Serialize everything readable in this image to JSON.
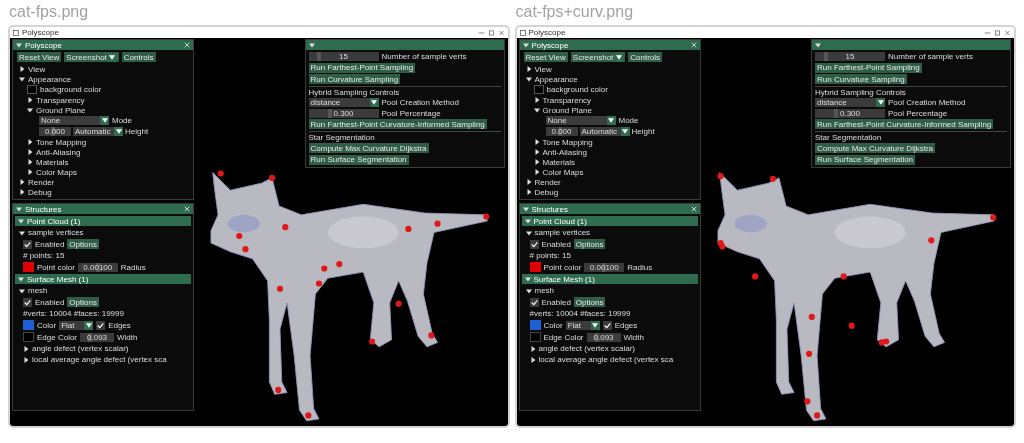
{
  "windows": [
    {
      "file_label": "cat-fps.png",
      "title": "Polyscope",
      "main_panel": {
        "title": "Polyscope",
        "buttons": [
          {
            "label": "Reset View",
            "kind": "plain"
          },
          {
            "label": "Screenshot",
            "kind": "menu"
          },
          {
            "label": "Controls",
            "kind": "plain"
          }
        ],
        "tree": [
          {
            "kind": "node",
            "label": "View",
            "expanded": false
          },
          {
            "kind": "node",
            "label": "Appearance",
            "expanded": true,
            "children": [
              {
                "kind": "color",
                "label": "background color",
                "color": "#000000"
              },
              {
                "kind": "node",
                "label": "Transparency",
                "expanded": false
              },
              {
                "kind": "node",
                "label": "Ground Plane",
                "expanded": true,
                "children": [
                  {
                    "kind": "select",
                    "value": "None",
                    "label": "Mode"
                  },
                  {
                    "kind": "drag_select",
                    "value": "0.000",
                    "level": 0.45,
                    "option": "Automatic",
                    "label": "Height"
                  }
                ]
              },
              {
                "kind": "node",
                "label": "Tone Mapping",
                "expanded": false
              },
              {
                "kind": "node",
                "label": "Anti-Aliasing",
                "expanded": false
              },
              {
                "kind": "node",
                "label": "Materials",
                "expanded": false
              },
              {
                "kind": "node",
                "label": "Color Maps",
                "expanded": false
              }
            ]
          },
          {
            "kind": "node",
            "label": "Render",
            "expanded": false
          },
          {
            "kind": "node",
            "label": "Debug",
            "expanded": false
          }
        ]
      },
      "structures": {
        "title": "Structures",
        "groups": [
          {
            "title": "Point Cloud (1)",
            "items": [
              {
                "name": "sample vertices",
                "expanded": true,
                "enabled": true,
                "enabled_label": "Enabled",
                "options": "Options",
                "info": "# points: 15",
                "color": "#e00000",
                "color_label": "Point color",
                "param": {
                  "value": "0.00100",
                  "level": 0.5,
                  "label": "Radius"
                }
              }
            ]
          },
          {
            "title": "Surface Mesh (1)",
            "items": [
              {
                "name": "mesh",
                "expanded": true,
                "enabled": true,
                "enabled_label": "Enabled",
                "options": "Options",
                "info": "#verts: 10004  #faces: 19999",
                "color": "#1f5fd6",
                "color_label": "Color",
                "style": "Flat",
                "edges": {
                  "checked": true,
                  "label": "Edges"
                },
                "edge_color": {
                  "color": "#000000",
                  "label": "Edge Color"
                },
                "param": {
                  "value": "0.093",
                  "level": 0.3,
                  "label": "Width"
                },
                "quantities": [
                  {
                    "label": "angle defect (vertex scalar)",
                    "expanded": false
                  },
                  {
                    "label": "local average angle defect (vertex sca",
                    "expanded": false
                  }
                ]
              }
            ]
          }
        ]
      },
      "tools": [
        {
          "kind": "slider",
          "reading": "15",
          "level": 0.15,
          "label": "Number of sample verts"
        },
        {
          "kind": "button",
          "label": "Run Farthest-Point Sampling"
        },
        {
          "kind": "button",
          "label": "Run Curvature Sampling"
        },
        {
          "kind": "heading",
          "label": "Hybrid Sampling Controls"
        },
        {
          "kind": "select",
          "option": "distance",
          "label": "Pool Creation Method"
        },
        {
          "kind": "slider",
          "reading": "0.300",
          "level": 0.3,
          "label": "Pool Percentage"
        },
        {
          "kind": "button",
          "label": "Run Farthest-Point Curvature-Informed Sampling"
        },
        {
          "kind": "heading",
          "label": "Star Segmentation"
        },
        {
          "kind": "button",
          "label": "Compute Max Curvature Dijkstra"
        },
        {
          "kind": "button",
          "label": "Run Surface Segmentation"
        }
      ]
    },
    {
      "file_label": "cat-fps+curv.png",
      "title": "Polyscope",
      "main_panel": {
        "title": "Polyscope",
        "buttons": [
          {
            "label": "Reset View",
            "kind": "plain"
          },
          {
            "label": "Screenshot",
            "kind": "menu"
          },
          {
            "label": "Controls",
            "kind": "plain"
          }
        ],
        "tree": [
          {
            "kind": "node",
            "label": "View",
            "expanded": false
          },
          {
            "kind": "node",
            "label": "Appearance",
            "expanded": true,
            "children": [
              {
                "kind": "color",
                "label": "background color",
                "color": "#000000"
              },
              {
                "kind": "node",
                "label": "Transparency",
                "expanded": false
              },
              {
                "kind": "node",
                "label": "Ground Plane",
                "expanded": true,
                "children": [
                  {
                    "kind": "select",
                    "value": "None",
                    "label": "Mode"
                  },
                  {
                    "kind": "drag_select",
                    "value": "0.000",
                    "level": 0.45,
                    "option": "Automatic",
                    "label": "Height"
                  }
                ]
              },
              {
                "kind": "node",
                "label": "Tone Mapping",
                "expanded": false
              },
              {
                "kind": "node",
                "label": "Anti-Aliasing",
                "expanded": false
              },
              {
                "kind": "node",
                "label": "Materials",
                "expanded": false
              },
              {
                "kind": "node",
                "label": "Color Maps",
                "expanded": false
              }
            ]
          },
          {
            "kind": "node",
            "label": "Render",
            "expanded": false
          },
          {
            "kind": "node",
            "label": "Debug",
            "expanded": false
          }
        ]
      },
      "structures": {
        "title": "Structures",
        "groups": [
          {
            "title": "Point Cloud (1)",
            "items": [
              {
                "name": "sample vertices",
                "expanded": true,
                "enabled": true,
                "enabled_label": "Enabled",
                "options": "Options",
                "info": "# points: 15",
                "color": "#e00000",
                "color_label": "Point color",
                "param": {
                  "value": "0.00100",
                  "level": 0.5,
                  "label": "Radius"
                }
              }
            ]
          },
          {
            "title": "Surface Mesh (1)",
            "items": [
              {
                "name": "mesh",
                "expanded": true,
                "enabled": true,
                "enabled_label": "Enabled",
                "options": "Options",
                "info": "#verts: 10004  #faces: 19999",
                "color": "#1f5fd6",
                "color_label": "Color",
                "style": "Flat",
                "edges": {
                  "checked": true,
                  "label": "Edges"
                },
                "edge_color": {
                  "color": "#000000",
                  "label": "Edge Color"
                },
                "param": {
                  "value": "0.093",
                  "level": 0.3,
                  "label": "Width"
                },
                "quantities": [
                  {
                    "label": "angle defect (vertex scalar)",
                    "expanded": false
                  },
                  {
                    "label": "local average angle defect (vertex sca",
                    "expanded": false
                  }
                ]
              }
            ]
          }
        ]
      },
      "tools": [
        {
          "kind": "slider",
          "reading": "15",
          "level": 0.15,
          "label": "Number of sample verts"
        },
        {
          "kind": "button",
          "label": "Run Farthest-Point Sampling"
        },
        {
          "kind": "button",
          "label": "Run Curvature Sampling"
        },
        {
          "kind": "heading",
          "label": "Hybrid Sampling Controls"
        },
        {
          "kind": "select",
          "option": "distance",
          "label": "Pool Creation Method"
        },
        {
          "kind": "slider",
          "reading": "0.300",
          "level": 0.3,
          "label": "Pool Percentage"
        },
        {
          "kind": "button",
          "label": "Run Farthest-Point Curvature-Informed Sampling"
        },
        {
          "kind": "heading",
          "label": "Star Segmentation"
        },
        {
          "kind": "button",
          "label": "Compute Max Curvature Dijkstra"
        },
        {
          "kind": "button",
          "label": "Run Surface Segmentation"
        }
      ]
    }
  ]
}
